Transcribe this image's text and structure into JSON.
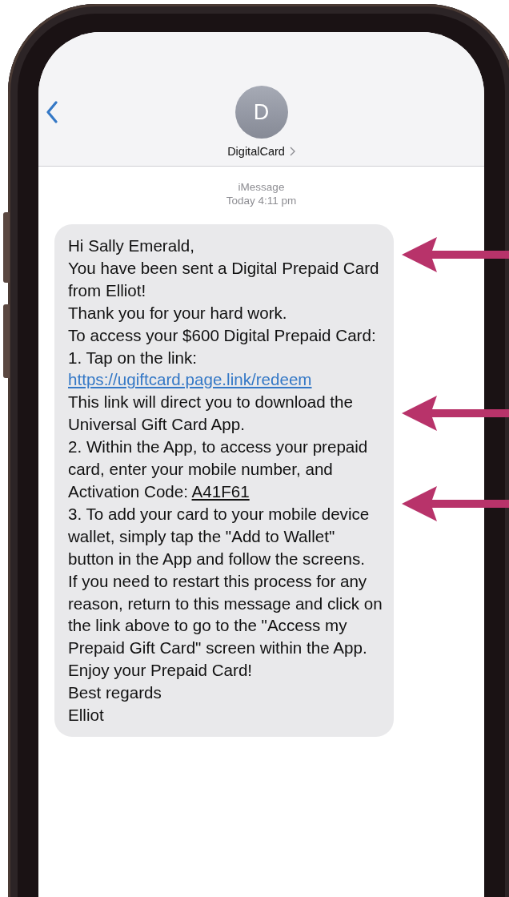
{
  "contact": {
    "initial": "D",
    "name": "DigitalCard"
  },
  "timestamp": {
    "service": "iMessage",
    "time": "Today 4:11 pm"
  },
  "message": {
    "paragraphs": [
      {
        "parts": [
          {
            "kind": "text",
            "text": "Hi Sally Emerald,"
          }
        ]
      },
      {
        "parts": [
          {
            "kind": "text",
            "text": "You have been sent a Digital Prepaid Card from Elliot!"
          }
        ]
      },
      {
        "parts": [
          {
            "kind": "text",
            "text": "Thank you for your hard work."
          }
        ]
      },
      {
        "parts": [
          {
            "kind": "text",
            "text": "To access your $600 Digital Prepaid Card:"
          }
        ]
      },
      {
        "parts": [
          {
            "kind": "text",
            "text": "1. Tap on the link: "
          },
          {
            "kind": "link",
            "text": "https://ugiftcard.page.link/redeem"
          }
        ]
      },
      {
        "parts": [
          {
            "kind": "text",
            "text": "This link will direct you to download the Universal Gift Card App."
          }
        ]
      },
      {
        "parts": [
          {
            "kind": "text",
            "text": "2. Within the App, to access your prepaid card, enter your mobile number, and Activation Code: "
          },
          {
            "kind": "code",
            "text": "A41F61"
          }
        ]
      },
      {
        "parts": [
          {
            "kind": "text",
            "text": "3. To add your card to your mobile device wallet, simply tap the \"Add to Wallet\" button in the App and follow the screens."
          }
        ]
      },
      {
        "parts": [
          {
            "kind": "text",
            "text": "If you need to restart this process for any reason, return to this message and click on the link above to go to the \"Access my Prepaid Gift Card\" screen within the App."
          }
        ]
      },
      {
        "parts": [
          {
            "kind": "text",
            "text": "Enjoy your Prepaid Card!"
          }
        ]
      },
      {
        "parts": [
          {
            "kind": "text",
            "text": "Best regards"
          }
        ]
      },
      {
        "parts": [
          {
            "kind": "text",
            "text": "Elliot"
          }
        ]
      }
    ]
  }
}
